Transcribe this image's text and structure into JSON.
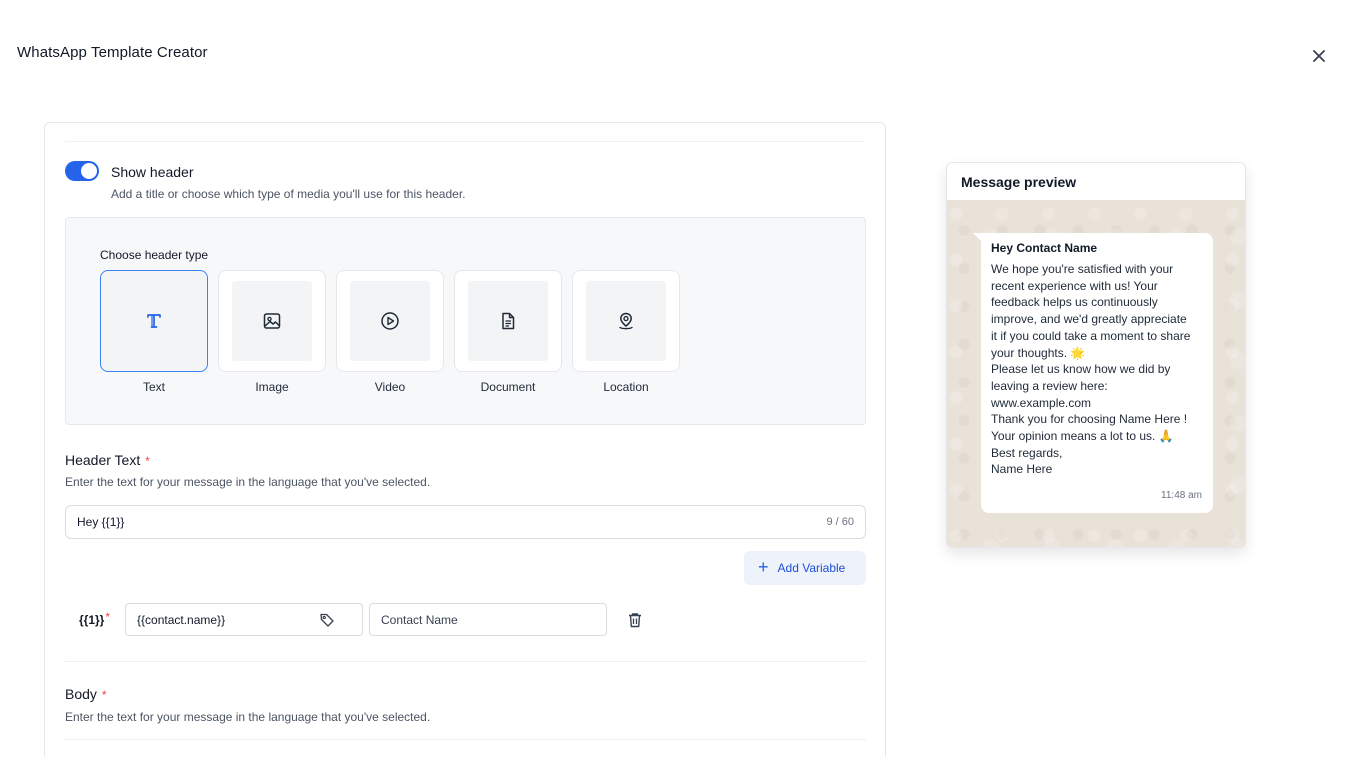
{
  "window": {
    "title": "WhatsApp Template Creator",
    "close_icon": "close-icon"
  },
  "header_section": {
    "toggle_on": true,
    "toggle_label": "Show header",
    "toggle_description": "Add a title or choose which type of media you'll use for this header.",
    "choose_label": "Choose header type",
    "types": [
      {
        "label": "Text",
        "icon": "text-icon",
        "selected": true
      },
      {
        "label": "Image",
        "icon": "image-icon",
        "selected": false
      },
      {
        "label": "Video",
        "icon": "play-circle-icon",
        "selected": false
      },
      {
        "label": "Document",
        "icon": "document-icon",
        "selected": false
      },
      {
        "label": "Location",
        "icon": "location-pin-icon",
        "selected": false
      }
    ]
  },
  "header_text": {
    "title": "Header Text",
    "required_mark": "*",
    "description": "Enter the text for your message in the language that you've selected.",
    "value": "Hey {{1}}",
    "char_count": "9 / 60",
    "add_variable_label": "Add Variable",
    "variable": {
      "token": "{{1}}",
      "required_mark": "*",
      "field_value": "{{contact.name}}",
      "sample_value": "Contact Name"
    }
  },
  "body_section": {
    "title": "Body",
    "required_mark": "*",
    "description": "Enter the text for your message in the language that you've selected."
  },
  "preview": {
    "title": "Message preview",
    "header": "Hey Contact Name",
    "body_lines": [
      "We hope you're satisfied with your",
      "recent experience with us! Your",
      "feedback helps us continuously",
      "improve, and we'd greatly appreciate",
      "it if you could take a moment to share",
      "your thoughts. 🌟",
      "Please let us know how we did by",
      "leaving a review here:",
      "www.example.com",
      "Thank you for choosing Name Here !",
      "Your opinion means a lot to us. 🙏",
      "Best regards,",
      "Name Here"
    ],
    "time": "11:48 am"
  },
  "colors": {
    "accent": "#2563eb",
    "required": "#ef4444",
    "chat_background": "#e9e2d8"
  }
}
